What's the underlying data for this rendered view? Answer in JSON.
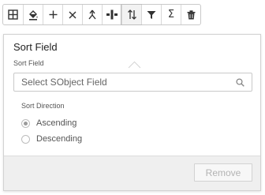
{
  "toolbar": {
    "buttons": [
      {
        "name": "grid-icon"
      },
      {
        "name": "fill-color-icon"
      },
      {
        "name": "add-icon"
      },
      {
        "name": "close-icon"
      },
      {
        "name": "merge-up-icon"
      },
      {
        "name": "column-split-icon"
      },
      {
        "name": "sort-icon",
        "active": true
      },
      {
        "name": "filter-icon"
      },
      {
        "name": "sum-icon",
        "text": "Σ"
      },
      {
        "name": "trash-icon"
      }
    ]
  },
  "popover": {
    "title": "Sort Field",
    "field_label": "Sort Field",
    "search_placeholder": "Select SObject Field",
    "direction_label": "Sort Direction",
    "options": [
      {
        "label": "Ascending",
        "checked": true
      },
      {
        "label": "Descending",
        "checked": false
      }
    ],
    "remove_label": "Remove"
  },
  "colors": {
    "disabled_text": "#b3b3b3",
    "footer_bg": "#efefef",
    "border": "#c9c9c9"
  }
}
